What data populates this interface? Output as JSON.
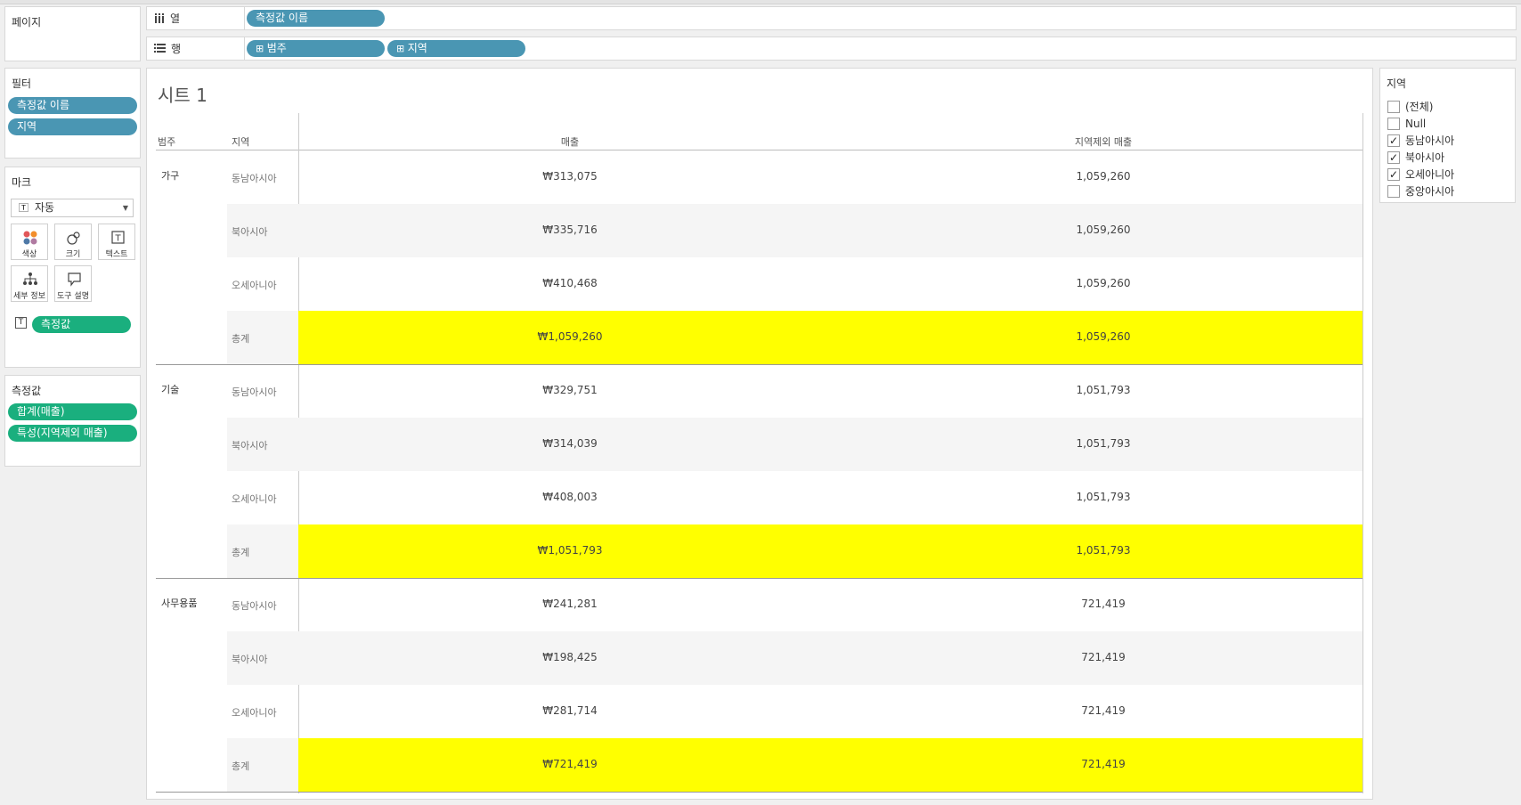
{
  "columns_shelf": {
    "label": "열",
    "pills": [
      "측정값 이름"
    ]
  },
  "rows_shelf": {
    "label": "행",
    "pills": [
      "범주",
      "지역"
    ]
  },
  "pages": {
    "title": "페이지"
  },
  "filters": {
    "title": "필터",
    "pills": [
      "측정값 이름",
      "지역"
    ]
  },
  "marks": {
    "title": "마크",
    "type": "자동",
    "buttons": [
      "색상",
      "크기",
      "텍스트",
      "세부 정보",
      "도구 설명"
    ],
    "text_pill": "측정값"
  },
  "measures": {
    "title": "측정값",
    "pills": [
      "합계(매출)",
      "특성(지역제외 매출)"
    ]
  },
  "sheet": {
    "title": "시트 1"
  },
  "table": {
    "headers": [
      "범주",
      "지역",
      "매출",
      "지역제외 매출"
    ],
    "categories": [
      {
        "name": "가구",
        "rows": [
          {
            "region": "동남아시아",
            "sales": "₩313,075",
            "excl": "1,059,260"
          },
          {
            "region": "북아시아",
            "sales": "₩335,716",
            "excl": "1,059,260"
          },
          {
            "region": "오세아니아",
            "sales": "₩410,468",
            "excl": "1,059,260"
          },
          {
            "region": "총계",
            "sales": "₩1,059,260",
            "excl": "1,059,260"
          }
        ]
      },
      {
        "name": "기술",
        "rows": [
          {
            "region": "동남아시아",
            "sales": "₩329,751",
            "excl": "1,051,793"
          },
          {
            "region": "북아시아",
            "sales": "₩314,039",
            "excl": "1,051,793"
          },
          {
            "region": "오세아니아",
            "sales": "₩408,003",
            "excl": "1,051,793"
          },
          {
            "region": "총계",
            "sales": "₩1,051,793",
            "excl": "1,051,793"
          }
        ]
      },
      {
        "name": "사무용품",
        "rows": [
          {
            "region": "동남아시아",
            "sales": "₩241,281",
            "excl": "721,419"
          },
          {
            "region": "북아시아",
            "sales": "₩198,425",
            "excl": "721,419"
          },
          {
            "region": "오세아니아",
            "sales": "₩281,714",
            "excl": "721,419"
          },
          {
            "region": "총계",
            "sales": "₩721,419",
            "excl": "721,419"
          }
        ]
      }
    ]
  },
  "legend": {
    "title": "지역",
    "items": [
      {
        "label": "(전체)",
        "checked": false
      },
      {
        "label": "Null",
        "checked": false
      },
      {
        "label": "동남아시아",
        "checked": true
      },
      {
        "label": "북아시아",
        "checked": true
      },
      {
        "label": "오세아니아",
        "checked": true
      },
      {
        "label": "중앙아시아",
        "checked": false
      }
    ]
  },
  "colors": {
    "highlight": "#ffff00",
    "pill_blue": "#4a96b3",
    "pill_green": "#1aaf7e",
    "band": "#f5f5f5"
  }
}
